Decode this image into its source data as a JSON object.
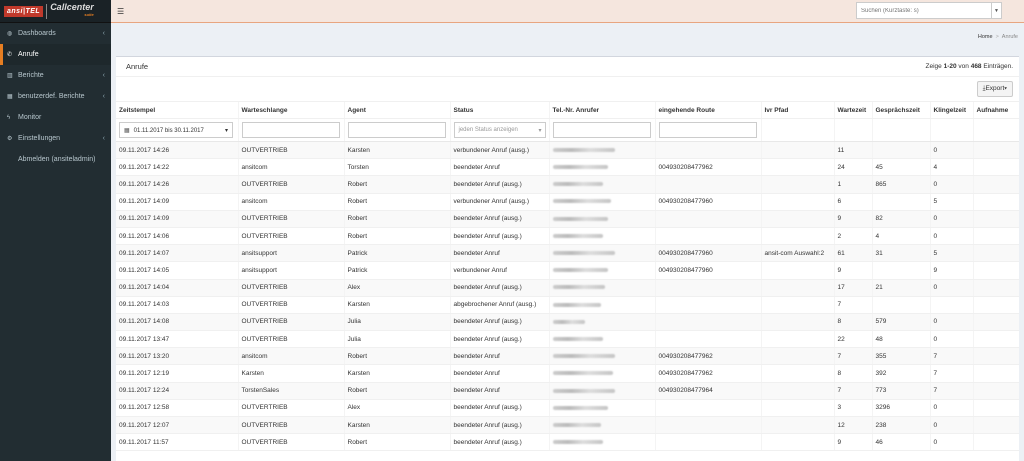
{
  "logo": {
    "brand": "ansi|TEL",
    "product": "Callcenter",
    "edition": "suite"
  },
  "sidebar": {
    "items": [
      {
        "label": "Dashboards",
        "icon": "dashboard-icon",
        "glyph": "◍",
        "arrow": true,
        "active": false
      },
      {
        "label": "Anrufe",
        "icon": "phone-icon",
        "glyph": "✆",
        "arrow": false,
        "active": true
      },
      {
        "label": "Berichte",
        "icon": "bar-chart-icon",
        "glyph": "▥",
        "arrow": true,
        "active": false
      },
      {
        "label": "benutzerdef. Berichte",
        "icon": "area-chart-icon",
        "glyph": "▦",
        "arrow": true,
        "active": false
      },
      {
        "label": "Monitor",
        "icon": "bolt-icon",
        "glyph": "ϟ",
        "arrow": false,
        "active": false
      },
      {
        "label": "Einstellungen",
        "icon": "gears-icon",
        "glyph": "⚙",
        "arrow": true,
        "active": false
      },
      {
        "label": "Abmelden (ansiteladmin)",
        "icon": "logout-icon",
        "glyph": "",
        "arrow": false,
        "active": false
      }
    ]
  },
  "topbar": {
    "menu_glyph": "☰",
    "search_placeholder": "Suchen (Kurztaste: s)"
  },
  "breadcrumb": {
    "home": "Home",
    "separator": ">",
    "current": "Anrufe"
  },
  "box": {
    "title": "Anrufe",
    "info_prefix": "Zeige ",
    "info_range": "1-20",
    "info_mid": " von ",
    "info_total": "468",
    "info_suffix": " Einträgen.",
    "export_label": "Export",
    "export_glyph": "⤓",
    "export_caret": "▾"
  },
  "table": {
    "headers": [
      "Zeitstempel",
      "Warteschlange",
      "Agent",
      "Status",
      "Tel.-Nr. Anrufer",
      "eingehende Route",
      "Ivr Pfad",
      "Wartezeit",
      "Gesprächszeit",
      "Klingelzeit",
      "Aufnahme"
    ],
    "filters": {
      "date_range": "01.11.2017 bis 30.11.2017",
      "status_placeholder": "jeden Status anzeigen"
    },
    "rows": [
      {
        "ts": "09.11.2017 14:26",
        "queue": "OUTVERTRIEB",
        "agent": "Karsten",
        "status": "verbundener Anruf (ausg.)",
        "caller_redacted": 62,
        "route": "",
        "ivr": "",
        "wait": "11",
        "talk": "",
        "ring": "0",
        "rec": ""
      },
      {
        "ts": "09.11.2017 14:22",
        "queue": "ansitcom",
        "agent": "Torsten",
        "status": "beendeter Anruf",
        "caller_redacted": 55,
        "route": "004930208477962",
        "ivr": "",
        "wait": "24",
        "talk": "45",
        "ring": "4",
        "rec": ""
      },
      {
        "ts": "09.11.2017 14:26",
        "queue": "OUTVERTRIEB",
        "agent": "Robert",
        "status": "beendeter Anruf (ausg.)",
        "caller_redacted": 50,
        "route": "",
        "ivr": "",
        "wait": "1",
        "talk": "865",
        "ring": "0",
        "rec": ""
      },
      {
        "ts": "09.11.2017 14:09",
        "queue": "ansitcom",
        "agent": "Robert",
        "status": "verbundener Anruf (ausg.)",
        "caller_redacted": 58,
        "route": "004930208477960",
        "ivr": "",
        "wait": "6",
        "talk": "",
        "ring": "5",
        "rec": ""
      },
      {
        "ts": "09.11.2017 14:09",
        "queue": "OUTVERTRIEB",
        "agent": "Robert",
        "status": "beendeter Anruf (ausg.)",
        "caller_redacted": 55,
        "route": "",
        "ivr": "",
        "wait": "9",
        "talk": "82",
        "ring": "0",
        "rec": ""
      },
      {
        "ts": "09.11.2017 14:06",
        "queue": "OUTVERTRIEB",
        "agent": "Robert",
        "status": "beendeter Anruf (ausg.)",
        "caller_redacted": 50,
        "route": "",
        "ivr": "",
        "wait": "2",
        "talk": "4",
        "ring": "0",
        "rec": ""
      },
      {
        "ts": "09.11.2017 14:07",
        "queue": "ansitsupport",
        "agent": "Patrick",
        "status": "beendeter Anruf",
        "caller_redacted": 62,
        "route": "004930208477960",
        "ivr": "ansit-com Auswahl:2",
        "wait": "61",
        "talk": "31",
        "ring": "5",
        "rec": ""
      },
      {
        "ts": "09.11.2017 14:05",
        "queue": "ansitsupport",
        "agent": "Patrick",
        "status": "verbundener Anruf",
        "caller_redacted": 55,
        "route": "004930208477960",
        "ivr": "",
        "wait": "9",
        "talk": "",
        "ring": "9",
        "rec": ""
      },
      {
        "ts": "09.11.2017 14:04",
        "queue": "OUTVERTRIEB",
        "agent": "Alex",
        "status": "beendeter Anruf (ausg.)",
        "caller_redacted": 52,
        "route": "",
        "ivr": "",
        "wait": "17",
        "talk": "21",
        "ring": "0",
        "rec": ""
      },
      {
        "ts": "09.11.2017 14:03",
        "queue": "OUTVERTRIEB",
        "agent": "Karsten",
        "status": "abgebrochener Anruf (ausg.)",
        "caller_redacted": 48,
        "route": "",
        "ivr": "",
        "wait": "7",
        "talk": "",
        "ring": "",
        "rec": ""
      },
      {
        "ts": "09.11.2017 14:08",
        "queue": "OUTVERTRIEB",
        "agent": "Julia",
        "status": "beendeter Anruf (ausg.)",
        "caller_redacted": 32,
        "route": "",
        "ivr": "",
        "wait": "8",
        "talk": "579",
        "ring": "0",
        "rec": ""
      },
      {
        "ts": "09.11.2017 13:47",
        "queue": "OUTVERTRIEB",
        "agent": "Julia",
        "status": "beendeter Anruf (ausg.)",
        "caller_redacted": 50,
        "route": "",
        "ivr": "",
        "wait": "22",
        "talk": "48",
        "ring": "0",
        "rec": ""
      },
      {
        "ts": "09.11.2017 13:20",
        "queue": "ansitcom",
        "agent": "Robert",
        "status": "beendeter Anruf",
        "caller_redacted": 62,
        "route": "004930208477962",
        "ivr": "",
        "wait": "7",
        "talk": "355",
        "ring": "7",
        "rec": ""
      },
      {
        "ts": "09.11.2017 12:19",
        "queue": "Karsten",
        "agent": "Karsten",
        "status": "beendeter Anruf",
        "caller_redacted": 60,
        "route": "004930208477962",
        "ivr": "",
        "wait": "8",
        "talk": "392",
        "ring": "7",
        "rec": ""
      },
      {
        "ts": "09.11.2017 12:24",
        "queue": "TorstenSales",
        "agent": "Robert",
        "status": "beendeter Anruf",
        "caller_redacted": 62,
        "route": "004930208477964",
        "ivr": "",
        "wait": "7",
        "talk": "773",
        "ring": "7",
        "rec": ""
      },
      {
        "ts": "09.11.2017 12:58",
        "queue": "OUTVERTRIEB",
        "agent": "Alex",
        "status": "beendeter Anruf (ausg.)",
        "caller_redacted": 55,
        "route": "",
        "ivr": "",
        "wait": "3",
        "talk": "3296",
        "ring": "0",
        "rec": ""
      },
      {
        "ts": "09.11.2017 12:07",
        "queue": "OUTVERTRIEB",
        "agent": "Karsten",
        "status": "beendeter Anruf (ausg.)",
        "caller_redacted": 48,
        "route": "",
        "ivr": "",
        "wait": "12",
        "talk": "238",
        "ring": "0",
        "rec": ""
      },
      {
        "ts": "09.11.2017 11:57",
        "queue": "OUTVERTRIEB",
        "agent": "Robert",
        "status": "beendeter Anruf (ausg.)",
        "caller_redacted": 50,
        "route": "",
        "ivr": "",
        "wait": "9",
        "talk": "46",
        "ring": "0",
        "rec": ""
      }
    ]
  }
}
